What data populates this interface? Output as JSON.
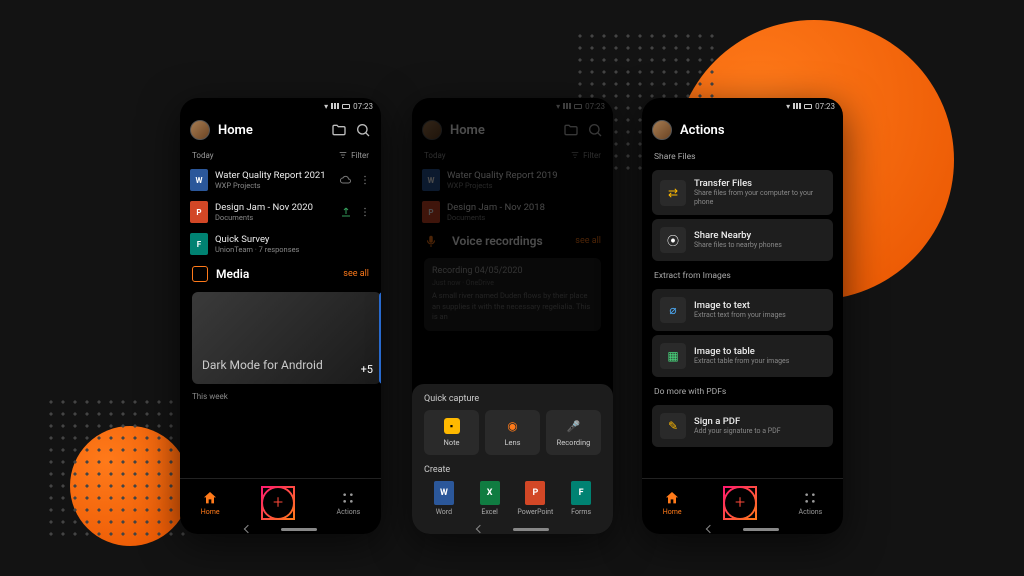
{
  "status_time": "07:23",
  "screen1": {
    "title": "Home",
    "section_today": "Today",
    "filter": "Filter",
    "files": [
      {
        "title": "Water Quality Report 2021",
        "sub": "WXP Projects",
        "type": "word"
      },
      {
        "title": "Design Jam - Nov 2020",
        "sub": "Documents",
        "type": "ppt"
      },
      {
        "title": "Quick Survey",
        "sub": "UnionTeam · 7 responses",
        "type": "forms"
      }
    ],
    "media_label": "Media",
    "see_all": "see all",
    "media_card_text": "Dark Mode for Android",
    "media_count": "+5",
    "week_label": "This week",
    "nav_home": "Home",
    "nav_actions": "Actions"
  },
  "screen2": {
    "title": "Home",
    "section_today": "Today",
    "filter": "Filter",
    "files": [
      {
        "title": "Water Quality Report 2019",
        "sub": "WXP Projects"
      },
      {
        "title": "Design Jam - Nov 2018",
        "sub": "Documents"
      }
    ],
    "voice_label": "Voice recordings",
    "see_all": "see all",
    "voice_card": {
      "title": "Recording 04/05/2020",
      "sub": "Just now · OneDrive",
      "body": "A small river named Duden flows by their place an supplies it with the necessary regelialia. This is an"
    },
    "sheet": {
      "quick_capture": "Quick capture",
      "create": "Create",
      "tiles": [
        {
          "label": "Note"
        },
        {
          "label": "Lens"
        },
        {
          "label": "Recording"
        }
      ],
      "create_items": [
        {
          "label": "Word"
        },
        {
          "label": "Excel"
        },
        {
          "label": "PowerPoint"
        },
        {
          "label": "Forms"
        }
      ]
    }
  },
  "screen3": {
    "title": "Actions",
    "share_label": "Share Files",
    "extract_label": "Extract from Images",
    "pdf_label": "Do more with PDFs",
    "actions": {
      "transfer": {
        "title": "Transfer Files",
        "sub": "Share files from your computer to your phone"
      },
      "nearby": {
        "title": "Share Nearby",
        "sub": "Share files to nearby phones"
      },
      "imgtext": {
        "title": "Image to text",
        "sub": "Extract text from your images"
      },
      "imgtable": {
        "title": "Image to table",
        "sub": "Extract table from your images"
      },
      "sign": {
        "title": "Sign a PDF",
        "sub": "Add your signature to a PDF"
      }
    },
    "nav_home": "Home",
    "nav_actions": "Actions"
  }
}
